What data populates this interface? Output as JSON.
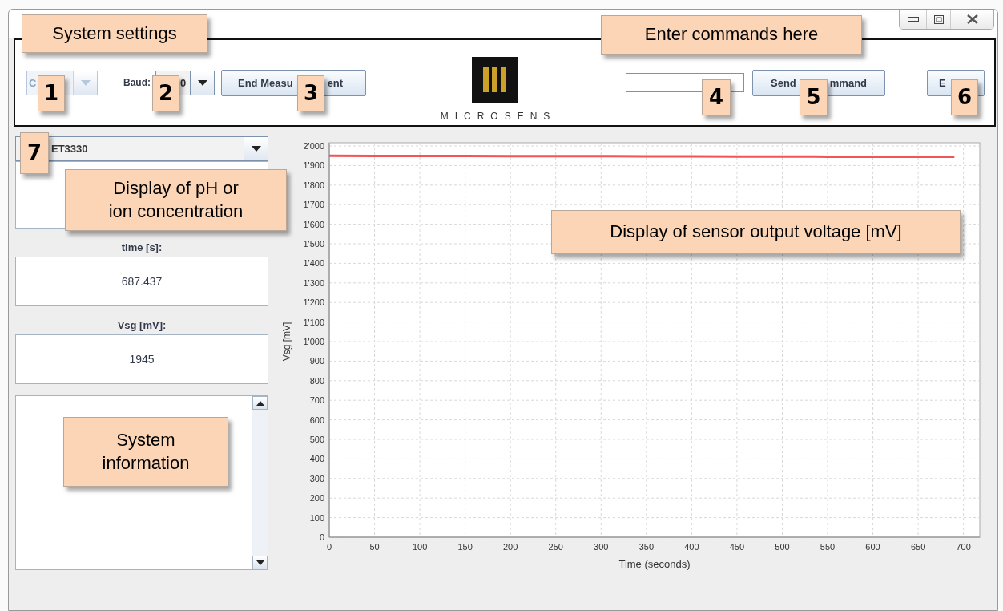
{
  "toolbar": {
    "port_combo": {
      "value": "C",
      "disabled": true
    },
    "baud_label": "Baud:",
    "baud_combo": {
      "value": "0"
    },
    "end_button": {
      "label_parts": [
        "End Measu",
        "ent"
      ]
    },
    "logo_text": "MICROSENS",
    "send_button": {
      "label_parts": [
        "Send",
        "mmand"
      ]
    },
    "exit_button": {
      "label_parts": [
        "E"
      ]
    }
  },
  "left_panel": {
    "sensor_combo": {
      "value": "ET3330"
    },
    "readouts": [
      {
        "label": "time [s]:",
        "value": "687.437"
      },
      {
        "label": "Vsg [mV]:",
        "value": "1945"
      }
    ]
  },
  "chart_data": {
    "type": "line",
    "xlabel": "Time (seconds)",
    "ylabel": "Vsg [mV]",
    "grid": true,
    "xlim": [
      0,
      718
    ],
    "ylim": [
      0,
      2000
    ],
    "xticks": [
      0,
      50,
      100,
      150,
      200,
      250,
      300,
      350,
      400,
      450,
      500,
      550,
      600,
      650,
      700
    ],
    "yticks": [
      {
        "value": 0,
        "label": "0"
      },
      {
        "value": 100,
        "label": "100"
      },
      {
        "value": 200,
        "label": "200"
      },
      {
        "value": 300,
        "label": "300"
      },
      {
        "value": 400,
        "label": "400"
      },
      {
        "value": 500,
        "label": "500"
      },
      {
        "value": 600,
        "label": "600"
      },
      {
        "value": 700,
        "label": "700"
      },
      {
        "value": 800,
        "label": "800"
      },
      {
        "value": 900,
        "label": "900"
      },
      {
        "value": 1000,
        "label": "1'000"
      },
      {
        "value": 1100,
        "label": "1'100"
      },
      {
        "value": 1200,
        "label": "1'200"
      },
      {
        "value": 1300,
        "label": "1'300"
      },
      {
        "value": 1400,
        "label": "1'400"
      },
      {
        "value": 1500,
        "label": "1'500"
      },
      {
        "value": 1600,
        "label": "1'600"
      },
      {
        "value": 1700,
        "label": "1'700"
      },
      {
        "value": 1800,
        "label": "1'800"
      },
      {
        "value": 1900,
        "label": "1'900"
      },
      {
        "value": 2000,
        "label": "2'000"
      }
    ],
    "x": [
      0,
      50,
      100,
      150,
      200,
      250,
      300,
      350,
      400,
      450,
      500,
      550,
      600,
      650,
      690
    ],
    "series": [
      {
        "color": "#f25555",
        "values": [
          1950,
          1949,
          1949,
          1949,
          1948,
          1948,
          1948,
          1947,
          1947,
          1946,
          1946,
          1945,
          1945,
          1945,
          1945
        ]
      }
    ]
  },
  "callouts": [
    {
      "kind": "label",
      "text": "System settings"
    },
    {
      "kind": "label",
      "text": "Enter commands here"
    },
    {
      "kind": "number",
      "text": "1"
    },
    {
      "kind": "number",
      "text": "2"
    },
    {
      "kind": "number",
      "text": "3"
    },
    {
      "kind": "number",
      "text": "4"
    },
    {
      "kind": "number",
      "text": "5"
    },
    {
      "kind": "number",
      "text": "6"
    },
    {
      "kind": "number",
      "text": "7"
    },
    {
      "kind": "label",
      "text": "Display of pH or\nion concentration"
    },
    {
      "kind": "label",
      "text": "Display of sensor output voltage [mV]"
    },
    {
      "kind": "label",
      "text": "System\ninformation"
    }
  ]
}
